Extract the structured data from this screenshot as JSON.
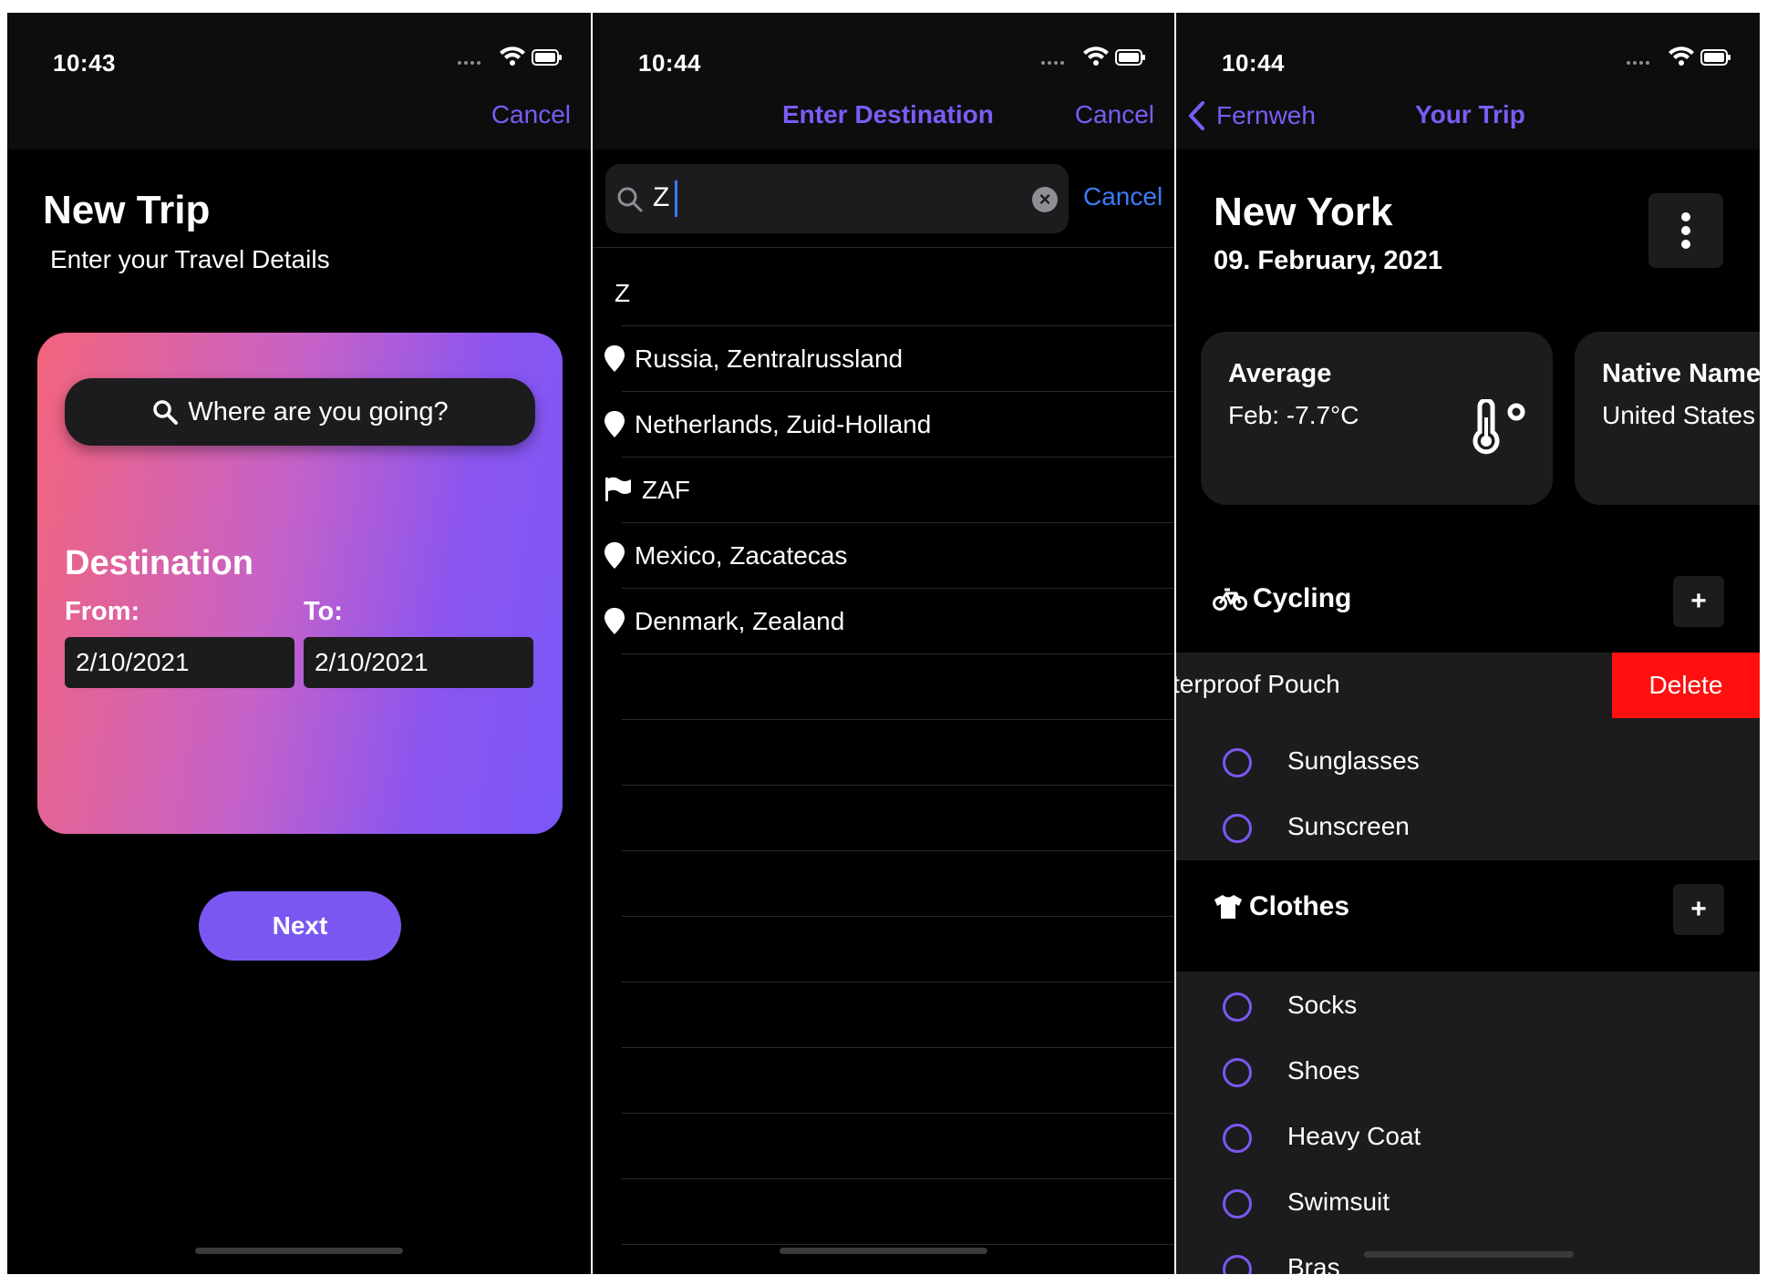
{
  "screen1": {
    "time": "10:43",
    "nav_cancel": "Cancel",
    "title": "New Trip",
    "subtitle": "Enter your Travel Details",
    "search_placeholder": "Where are you going?",
    "destination_label": "Destination",
    "from_label": "From:",
    "to_label": "To:",
    "from_date": "2/10/2021",
    "to_date": "2/10/2021",
    "next_label": "Next"
  },
  "screen2": {
    "time": "10:44",
    "nav_title": "Enter Destination",
    "nav_cancel": "Cancel",
    "search_text": "Z",
    "search_cancel": "Cancel",
    "results": [
      {
        "icon": "none-icon",
        "text": "Z"
      },
      {
        "icon": "location-pin-icon",
        "text": "Russia, Zentralrussland"
      },
      {
        "icon": "location-pin-icon",
        "text": "Netherlands, Zuid-Holland"
      },
      {
        "icon": "flag-icon",
        "text": "ZAF"
      },
      {
        "icon": "location-pin-icon",
        "text": "Mexico, Zacatecas"
      },
      {
        "icon": "location-pin-icon",
        "text": "Denmark, Zealand"
      }
    ]
  },
  "screen3": {
    "time": "10:44",
    "back_label": "Fernweh",
    "nav_title": "Your Trip",
    "city": "New York",
    "date": "09. February, 2021",
    "weather_card": {
      "title": "Average",
      "value": "Feb: -7.7°C"
    },
    "native_card": {
      "title": "Native Name",
      "value": "United States"
    },
    "sections": [
      {
        "title": "Cycling",
        "icon": "bicycle-icon",
        "swiped_item": "terproof Pouch",
        "delete_label": "Delete",
        "items": [
          "Sunglasses",
          "Sunscreen"
        ]
      },
      {
        "title": "Clothes",
        "icon": "tshirt-icon",
        "items": [
          "Socks",
          "Shoes",
          "Heavy Coat",
          "Swimsuit",
          "Bras"
        ]
      }
    ]
  },
  "colors": {
    "accent": "#7b57f2",
    "link_blue": "#3b7cf5",
    "delete_red": "#ff0f0f",
    "card_gradient_start": "#f3647c",
    "card_gradient_end": "#7a57f7",
    "surface": "#1c1c1e"
  }
}
